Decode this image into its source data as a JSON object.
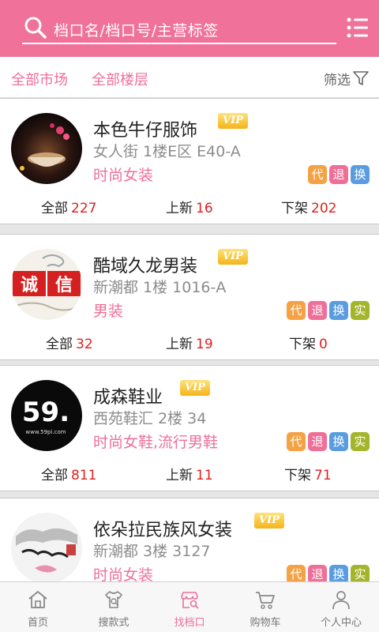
{
  "search": {
    "placeholder": "档口名/档口号/主营标签"
  },
  "filters": {
    "all_market": "全部市场",
    "all_floor": "全部楼层",
    "filter_label": "筛选"
  },
  "vip_label": "VIP",
  "shops": [
    {
      "name": "本色牛仔服饰",
      "address": "女人街 1楼E区 E40-A",
      "tags": "时尚女装",
      "badges": [
        "代",
        "退",
        "换"
      ],
      "stats": {
        "all_label": "全部",
        "all": "227",
        "new_label": "上新",
        "new": "16",
        "off_label": "下架",
        "off": "202"
      }
    },
    {
      "name": "酷域久龙男装",
      "address": "新潮都 1楼 1016-A",
      "tags": "男装",
      "badges": [
        "代",
        "退",
        "换",
        "实"
      ],
      "logo_text": "诚信",
      "stats": {
        "all_label": "全部",
        "all": "32",
        "new_label": "上新",
        "new": "19",
        "off_label": "下架",
        "off": "0"
      }
    },
    {
      "name": "成森鞋业",
      "address": "西苑鞋汇 2楼 34",
      "tags": "时尚女鞋,流行男鞋",
      "badges": [
        "代",
        "退",
        "换",
        "实"
      ],
      "logo_text": "59.",
      "logo_sub": "www.59pi.com",
      "stats": {
        "all_label": "全部",
        "all": "811",
        "new_label": "上新",
        "new": "11",
        "off_label": "下架",
        "off": "71"
      }
    },
    {
      "name": "依朵拉民族风女装",
      "address": "新潮都 3楼 3127",
      "tags": "时尚女装",
      "badges": [
        "代",
        "退",
        "换",
        "实"
      ]
    }
  ],
  "tabs": [
    {
      "label": "首页",
      "icon": "home-icon"
    },
    {
      "label": "搜款式",
      "icon": "shirt-search-icon"
    },
    {
      "label": "找档口",
      "icon": "store-search-icon",
      "active": true
    },
    {
      "label": "购物车",
      "icon": "cart-icon"
    },
    {
      "label": "个人中心",
      "icon": "person-icon"
    }
  ],
  "colors": {
    "brand_pink": "#f0719a",
    "price_red": "#e02020",
    "badge_orange": "#f5a244",
    "badge_blue": "#5a9ce0",
    "badge_green": "#a3b52a"
  }
}
